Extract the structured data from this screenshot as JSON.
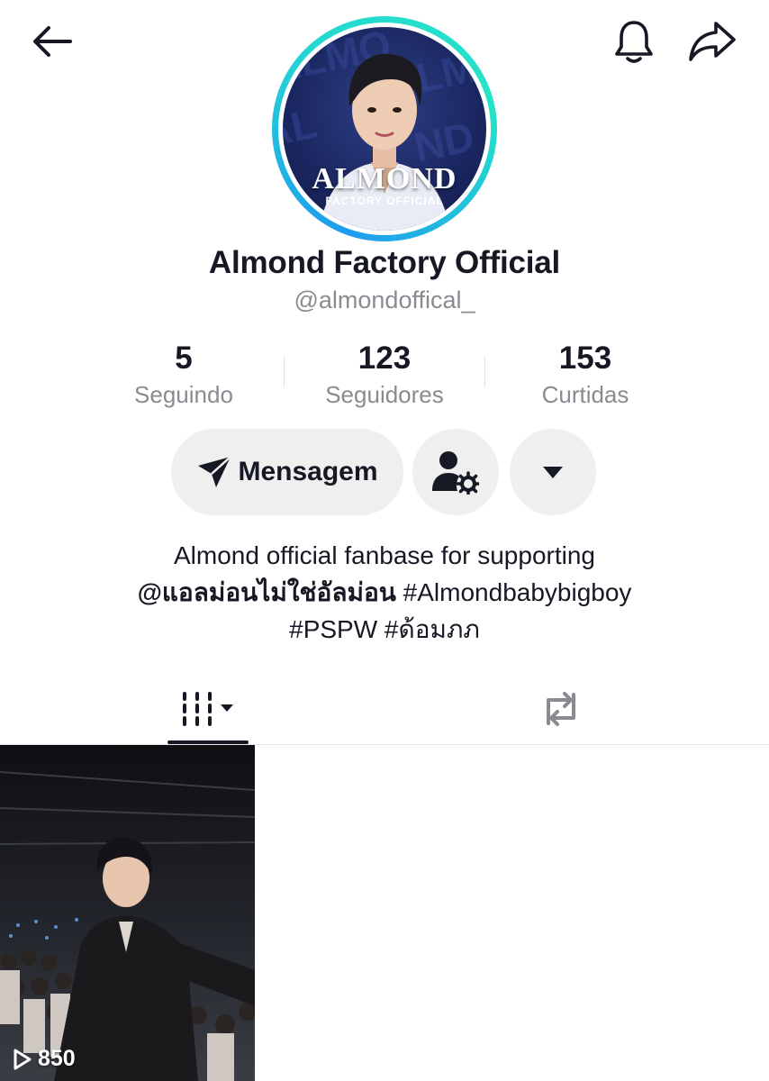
{
  "header": {
    "back_icon": "arrow-left-icon",
    "notification_icon": "bell-icon",
    "share_icon": "share-arrow-icon"
  },
  "profile": {
    "avatar_text": "ALMOND",
    "avatar_subtext": "FACTORY OFFICIAL",
    "display_name": "Almond Factory Official",
    "username": "@almondoffical_"
  },
  "stats": [
    {
      "value": "5",
      "label": "Seguindo"
    },
    {
      "value": "123",
      "label": "Seguidores"
    },
    {
      "value": "153",
      "label": "Curtidas"
    }
  ],
  "actions": {
    "message_label": "Mensagem",
    "message_icon": "send-icon",
    "friends_icon": "user-settings-icon",
    "more_icon": "caret-down-icon"
  },
  "bio": {
    "line1": "Almond official fanbase for supporting",
    "mention": "@แอลม่อนไม่ใช่อัลม่อน",
    "line2_rest": " #Almondbabybigboy",
    "line3": "#PSPW #ด้อมภภ"
  },
  "tabs": {
    "videos_icon": "video-grid-icon",
    "reposts_icon": "repost-icon"
  },
  "videos": [
    {
      "play_count": "850"
    }
  ],
  "colors": {
    "primary_text": "#161823",
    "secondary_text": "#8a8b91",
    "button_bg": "#efeff0",
    "ring_start": "#1e9bf0",
    "ring_end": "#25e3c8"
  }
}
